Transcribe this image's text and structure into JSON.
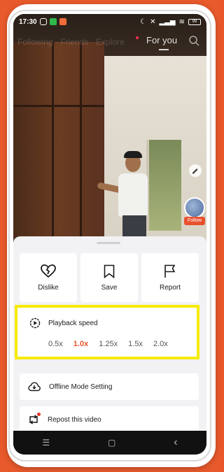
{
  "status_bar": {
    "time": "17:30",
    "battery": "99"
  },
  "header": {
    "blurred_tab": "Following · Friends · Explore",
    "for_you_tab": "For you"
  },
  "video": {
    "follow_label": "Follow"
  },
  "actions": [
    {
      "label": "Dislike",
      "icon": "broken-heart-icon"
    },
    {
      "label": "Save",
      "icon": "bookmark-icon"
    },
    {
      "label": "Report",
      "icon": "flag-icon"
    }
  ],
  "playback": {
    "title": "Playback speed",
    "options": [
      "0.5x",
      "1.0x",
      "1.25x",
      "1.5x",
      "2.0x"
    ],
    "selected": "1.0x",
    "accent_color": "#e8562a",
    "highlight_color": "#f6eb00"
  },
  "menu": {
    "offline": "Offline Mode Setting",
    "repost": "Repost this video"
  },
  "navbar": {
    "menu_glyph": "☰",
    "home_glyph": "▢",
    "back_glyph": "‹"
  }
}
